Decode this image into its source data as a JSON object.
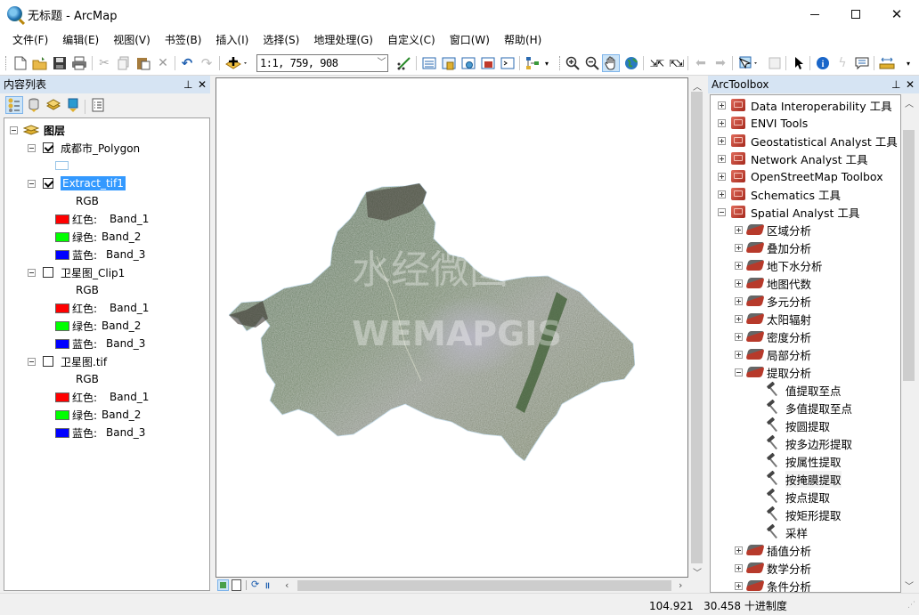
{
  "window": {
    "title": "无标题 - ArcMap",
    "minimize_label": "minimize",
    "maximize_label": "maximize",
    "close_label": "close"
  },
  "menu": [
    {
      "label": "文件(F)"
    },
    {
      "label": "编辑(E)"
    },
    {
      "label": "视图(V)"
    },
    {
      "label": "书签(B)"
    },
    {
      "label": "插入(I)"
    },
    {
      "label": "选择(S)"
    },
    {
      "label": "地理处理(G)"
    },
    {
      "label": "自定义(C)"
    },
    {
      "label": "窗口(W)"
    },
    {
      "label": "帮助(H)"
    }
  ],
  "toolbar": {
    "scale_value": "1:1, 759, 908",
    "icons": [
      "new-document",
      "open-folder",
      "save",
      "print",
      "cut",
      "copy",
      "paste",
      "delete",
      "undo",
      "redo",
      "add-data",
      "editor",
      "table-of-contents",
      "catalog",
      "search-window",
      "arctoolbox",
      "python-window",
      "model-builder",
      "zoom-in",
      "zoom-out",
      "pan",
      "full-extent",
      "fixed-zoom-in",
      "fixed-zoom-out",
      "go-back",
      "go-forward",
      "select-features",
      "clear-selection",
      "select-elements",
      "identify",
      "hyperlink",
      "html-popup",
      "measure"
    ]
  },
  "toc": {
    "title": "内容列表",
    "root_label": "图层",
    "layers": [
      {
        "name": "成都市_Polygon",
        "checked": true,
        "type": "polygon"
      },
      {
        "name": "Extract_tif1",
        "checked": true,
        "selected": true,
        "type": "raster",
        "renderer": "RGB",
        "bands": [
          {
            "channel": "红色:",
            "band": "Band_1",
            "color": "#ff0000"
          },
          {
            "channel": "绿色:",
            "band": "Band_2",
            "color": "#00ff00"
          },
          {
            "channel": "蓝色:",
            "band": "Band_3",
            "color": "#0000ff"
          }
        ]
      },
      {
        "name": "卫星图_Clip1",
        "checked": false,
        "type": "raster",
        "renderer": "RGB",
        "bands": [
          {
            "channel": "红色:",
            "band": "Band_1",
            "color": "#ff0000"
          },
          {
            "channel": "绿色:",
            "band": "Band_2",
            "color": "#00ff00"
          },
          {
            "channel": "蓝色:",
            "band": "Band_3",
            "color": "#0000ff"
          }
        ]
      },
      {
        "name": "卫星图.tif",
        "checked": false,
        "type": "raster",
        "renderer": "RGB",
        "bands": [
          {
            "channel": "红色:",
            "band": "Band_1",
            "color": "#ff0000"
          },
          {
            "channel": "绿色:",
            "band": "Band_2",
            "color": "#00ff00"
          },
          {
            "channel": "蓝色:",
            "band": "Band_3",
            "color": "#0000ff"
          }
        ]
      }
    ]
  },
  "map": {
    "watermark_cn": "水经微图",
    "watermark_en": "WEMAPGIS"
  },
  "toolbox": {
    "title": "ArcToolbox",
    "toolboxes": [
      {
        "label": "Data Interoperability 工具",
        "expanded": false
      },
      {
        "label": "ENVI Tools",
        "expanded": false
      },
      {
        "label": "Geostatistical Analyst 工具",
        "expanded": false
      },
      {
        "label": "Network Analyst 工具",
        "expanded": false
      },
      {
        "label": "OpenStreetMap Toolbox",
        "expanded": false
      },
      {
        "label": "Schematics 工具",
        "expanded": false
      },
      {
        "label": "Spatial Analyst 工具",
        "expanded": true
      }
    ],
    "toolsets": [
      {
        "label": "区域分析",
        "expanded": false
      },
      {
        "label": "叠加分析",
        "expanded": false
      },
      {
        "label": "地下水分析",
        "expanded": false
      },
      {
        "label": "地图代数",
        "expanded": false
      },
      {
        "label": "多元分析",
        "expanded": false
      },
      {
        "label": "太阳辐射",
        "expanded": false
      },
      {
        "label": "密度分析",
        "expanded": false
      },
      {
        "label": "局部分析",
        "expanded": false
      },
      {
        "label": "提取分析",
        "expanded": true
      }
    ],
    "tools": [
      {
        "label": "值提取至点"
      },
      {
        "label": "多值提取至点"
      },
      {
        "label": "按圆提取"
      },
      {
        "label": "按多边形提取"
      },
      {
        "label": "按属性提取"
      },
      {
        "label": "按掩膜提取",
        "hovered": true
      },
      {
        "label": "按点提取"
      },
      {
        "label": "按矩形提取"
      },
      {
        "label": "采样"
      }
    ],
    "toolsets_after": [
      {
        "label": "插值分析",
        "expanded": false
      },
      {
        "label": "数学分析",
        "expanded": false
      },
      {
        "label": "条件分析",
        "expanded": false
      }
    ]
  },
  "status": {
    "x": "104.921",
    "y": "30.458",
    "units": "十进制度"
  }
}
